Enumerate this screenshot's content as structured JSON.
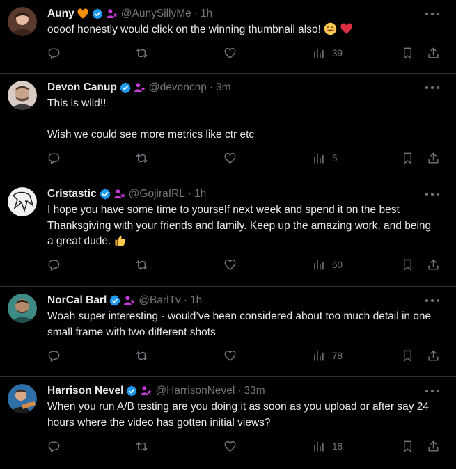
{
  "tweets": [
    {
      "name": "Auny",
      "handle": "@AunySillyMe",
      "time": "1h",
      "paragraphs": [
        "oooof honestly would click on the winning thumbnail also!"
      ],
      "name_emoji": "orange-heart-icon",
      "text_emojis": [
        "smiling-face-icon",
        "red-heart-icon"
      ],
      "views": "39",
      "avatar_colors": [
        "#e8b9a3",
        "#3a241c"
      ]
    },
    {
      "name": "Devon Canup",
      "handle": "@devoncnp",
      "time": "3m",
      "paragraphs": [
        "This is wild!!",
        "Wish we could see more metrics like ctr etc"
      ],
      "views": "5",
      "avatar_colors": [
        "#d7cbc3",
        "#6b4d3e"
      ]
    },
    {
      "name": "Cristastic",
      "handle": "@GojiraIRL",
      "time": "1h",
      "paragraphs": [
        "I hope you have some time to yourself next week and spend it on the best Thanksgiving with your friends and family. Keep up the amazing work, and being a great dude."
      ],
      "text_emojis": [
        "thumbs-up-icon"
      ],
      "views": "60",
      "avatar_colors": [
        "#f2f2f2",
        "#222222"
      ]
    },
    {
      "name": "NorCal Barl",
      "handle": "@BarlTv",
      "time": "1h",
      "paragraphs": [
        "Woah super interesting - would’ve been considered about too much detail in one small frame with two different shots"
      ],
      "views": "78",
      "avatar_colors": [
        "#3e8b86",
        "#b58a6a"
      ]
    },
    {
      "name": "Harrison Nevel",
      "handle": "@HarrisonNevel",
      "time": "33m",
      "paragraphs": [
        "When you run A/B testing are you doing it as soon as you upload or after say 24 hours where the video has gotten initial views?"
      ],
      "views": "18",
      "avatar_colors": [
        "#2f6fa8",
        "#d88a4a"
      ]
    }
  ],
  "colors": {
    "background": "#000000",
    "text": "#e7e9ea",
    "muted": "#71767b",
    "verified": "#1d9bf0",
    "affiliate": "#c239d6",
    "divider": "#2f3336"
  }
}
